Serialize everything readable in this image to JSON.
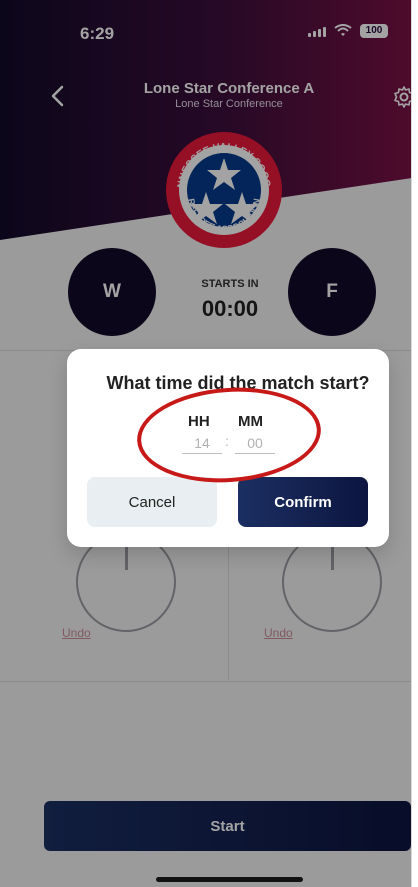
{
  "status_bar": {
    "time": "6:29",
    "battery": "100"
  },
  "header": {
    "title": "Lone Star Conference A",
    "subtitle": "Lone Star Conference"
  },
  "logo": {
    "top_text": "TENNESSEE VALLEY SOCCER",
    "bottom_text": "REFEREE ASSOCIATION"
  },
  "teams": {
    "left": "W",
    "right": "F"
  },
  "timer": {
    "label": "STARTS IN",
    "value": "00:00"
  },
  "controls": {
    "undo_left": "Undo",
    "undo_right": "Undo",
    "start": "Start"
  },
  "dialog": {
    "title": "What time did the match start?",
    "hh_label": "HH",
    "mm_label": "MM",
    "hour_value": "14",
    "minute_value": "00",
    "cancel": "Cancel",
    "confirm": "Confirm"
  },
  "colors": {
    "header_dark": "#130a2a",
    "header_accent": "#7b1245",
    "button_blue": "#1b2f62",
    "annotation_red": "#c81919"
  },
  "icons": {
    "back": "chevron-left-icon",
    "settings": "gear-icon"
  }
}
